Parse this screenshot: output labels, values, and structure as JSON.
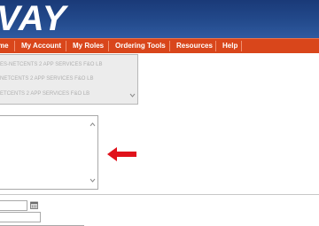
{
  "banner": {
    "logo_text": "VAY"
  },
  "nav": {
    "items": [
      {
        "label": "me"
      },
      {
        "label": "My Account"
      },
      {
        "label": "My Roles"
      },
      {
        "label": "Ordering Tools"
      },
      {
        "label": "Resources"
      },
      {
        "label": "Help"
      }
    ]
  },
  "role_list": {
    "options": [
      "ES-NETCENTS 2 APP SERVICES F&O LB",
      "NETCENTS 2 APP SERVICES F&O LB",
      "ETCENTS 2 APP SERVICES F&O LB"
    ]
  },
  "colors": {
    "banner": "#234a8c",
    "nav_bar": "#d9461b",
    "arrow": "#e0121b"
  },
  "icons": {
    "arrow": "arrow-left-icon",
    "calendar": "calendar-icon"
  }
}
